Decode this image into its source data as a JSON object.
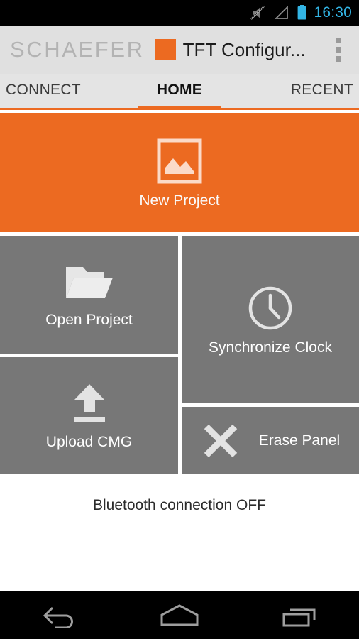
{
  "statusbar": {
    "time": "16:30",
    "icons": [
      "mute-icon",
      "signal-icon",
      "battery-icon"
    ],
    "accent_color": "#33b5e5",
    "background": "#000000"
  },
  "appbar": {
    "brand": "SCHAEFER",
    "brand_square_color": "#ec6a21",
    "title": "TFT Configur...",
    "overflow_label": "More options",
    "background": "#e0e0e0"
  },
  "tabs": {
    "items": [
      {
        "label": "CONNECT",
        "active": false
      },
      {
        "label": "HOME",
        "active": true
      },
      {
        "label": "RECENT",
        "active": false
      }
    ],
    "indicator_color": "#ec6a21"
  },
  "tiles": [
    {
      "label": "New Project",
      "icon": "image-icon",
      "color": "#ec6a21"
    },
    {
      "label": "Open Project",
      "icon": "folder-icon",
      "color": "#777777"
    },
    {
      "label": "Synchronize Clock",
      "icon": "clock-icon",
      "color": "#777777"
    },
    {
      "label": "Upload CMG",
      "icon": "upload-icon",
      "color": "#777777"
    },
    {
      "label": "Erase Panel",
      "icon": "close-x-icon",
      "color": "#777777"
    }
  ],
  "status": {
    "bluetooth_text": "Bluetooth connection OFF"
  },
  "navbar": {
    "back_label": "Back",
    "home_label": "Home",
    "recents_label": "Recent apps"
  }
}
